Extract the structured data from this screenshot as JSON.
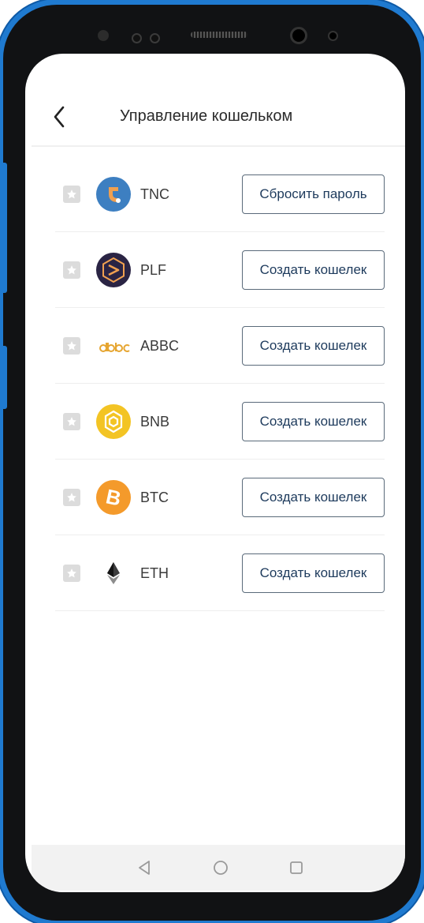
{
  "header": {
    "title": "Управление кошельком"
  },
  "wallets": [
    {
      "symbol": "TNC",
      "icon": "tnc-coin-icon",
      "action": "Сбросить пароль",
      "color": "#3d7fc1"
    },
    {
      "symbol": "PLF",
      "icon": "plf-coin-icon",
      "action": "Создать кошелек",
      "color": "#2a2444"
    },
    {
      "symbol": "ABBC",
      "icon": "abbc-coin-icon",
      "action": "Создать кошелек",
      "color": "#e6a530"
    },
    {
      "symbol": "BNB",
      "icon": "bnb-coin-icon",
      "action": "Создать кошелек",
      "color": "#f3c424"
    },
    {
      "symbol": "BTC",
      "icon": "btc-coin-icon",
      "action": "Создать кошелек",
      "color": "#f49a2b"
    },
    {
      "symbol": "ETH",
      "icon": "eth-coin-icon",
      "action": "Создать кошелек",
      "color": "#3c3c3d"
    }
  ],
  "navbar": {
    "buttons": [
      "back-triangle-icon",
      "home-circle-icon",
      "recents-square-icon"
    ]
  },
  "colors": {
    "frame": "#1f7ad0",
    "button_border": "#5a6a7a",
    "button_text": "#1d3a5c"
  }
}
